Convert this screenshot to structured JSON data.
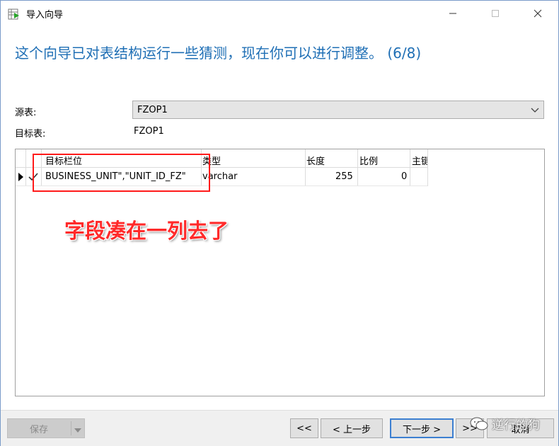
{
  "window": {
    "title": "导入向导"
  },
  "headline": "这个向导已对表结构运行一些猜测，现在你可以进行调整。 (6/8)",
  "source": {
    "label": "源表:",
    "value": "FZOP1"
  },
  "target": {
    "label": "目标表:",
    "value": "FZOP1"
  },
  "grid": {
    "columns": [
      "目标栏位",
      "类型",
      "长度",
      "比例",
      "主键"
    ],
    "rows": [
      {
        "field": "BUSINESS_UNIT\",\"UNIT_ID_FZ\"",
        "type": "varchar",
        "length": "255",
        "scale": "0",
        "primary": "",
        "checked": true
      }
    ]
  },
  "annotation": {
    "text": "字段凑在一列去了",
    "color": "#ff2a2a"
  },
  "buttons": {
    "save": "保存",
    "first": "<<",
    "prev": "< 上一步",
    "next": "下一步 >",
    "last": ">>",
    "cancel": "取消"
  },
  "watermark": "逆行的狗",
  "colors": {
    "accent": "#1f6fb5",
    "annotation_red": "#ff1a1a",
    "focus_blue": "#3c7fd1"
  },
  "icons": {
    "app": "table-import-icon",
    "minimize": "minimize-icon",
    "maximize": "maximize-icon",
    "close": "close-icon",
    "dropdown": "chevron-down-icon",
    "row_pointer": "row-pointer-icon",
    "check": "check-icon",
    "watermark": "wechat-icon"
  }
}
